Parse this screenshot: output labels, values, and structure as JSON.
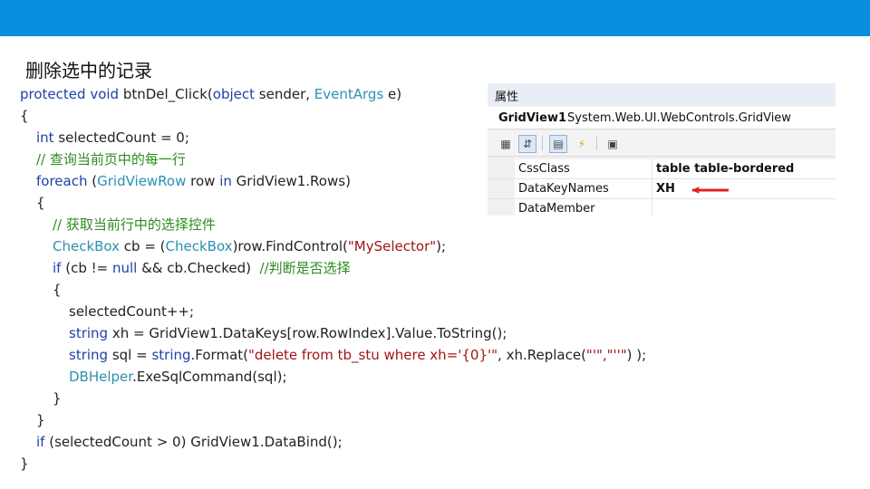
{
  "slide": {
    "title": "删除选中的记录"
  },
  "code": {
    "line1": {
      "kw1": "protected",
      "kw2": "void",
      "rest": " btnDel_Click(",
      "kw3": "object",
      "rest2": " sender, ",
      "ty": "EventArgs",
      "rest3": " e)"
    },
    "line2": "{",
    "line3": {
      "kw": "int",
      "rest": " selectedCount = 0;"
    },
    "line4": "// 查询当前页中的每一行",
    "line5": {
      "kw": "foreach",
      "p1": " (",
      "ty": "GridViewRow",
      "p2": " row ",
      "kw2": "in",
      "p3": " GridView1.Rows)"
    },
    "line6": "{",
    "line7": "// 获取当前行中的选择控件",
    "line8": {
      "ty": "CheckBox",
      "p1": " cb = (",
      "ty2": "CheckBox",
      "p2": ")row.FindControl(",
      "st": "\"MySelector\"",
      "p3": ");"
    },
    "line9": {
      "kw": "if",
      "p1": " (cb != ",
      "kw2": "null",
      "p2": " && cb.Checked)  ",
      "cm": "//判断是否选择"
    },
    "line10": "{",
    "line11": "selectedCount++;",
    "line12": {
      "kw": "string",
      "rest": " xh = GridView1.DataKeys[row.RowIndex].Value.ToString();"
    },
    "line13": {
      "kw": "string",
      "p1": " sql = ",
      "kw2": "string",
      "p2": ".Format(",
      "st": "\"delete from tb_stu where xh='{0}'\"",
      "p3": ", xh.Replace(",
      "st2": "\"'\",\"''\"",
      "p4": ") );"
    },
    "line14": {
      "ty": "DBHelper",
      "rest": ".ExeSqlCommand(sql);"
    },
    "line15": "}",
    "line16": "}",
    "line17": {
      "kw": "if",
      "rest": " (selectedCount > 0) GridView1.DataBind();"
    },
    "line18": "}"
  },
  "properties": {
    "header": "属性",
    "object_name": "GridView1",
    "object_type": "System.Web.UI.WebControls.GridView",
    "rows": [
      {
        "name": "CssClass",
        "value": "table table-bordered"
      },
      {
        "name": "DataKeyNames",
        "value": "XH"
      },
      {
        "name": "DataMember",
        "value": ""
      }
    ]
  },
  "colors": {
    "top_bar": "#0a8fde",
    "keyword": "#1f3fa8",
    "type": "#2b91af",
    "comment": "#2e8b20",
    "string": "#a31515",
    "arrow": "#e02020"
  }
}
